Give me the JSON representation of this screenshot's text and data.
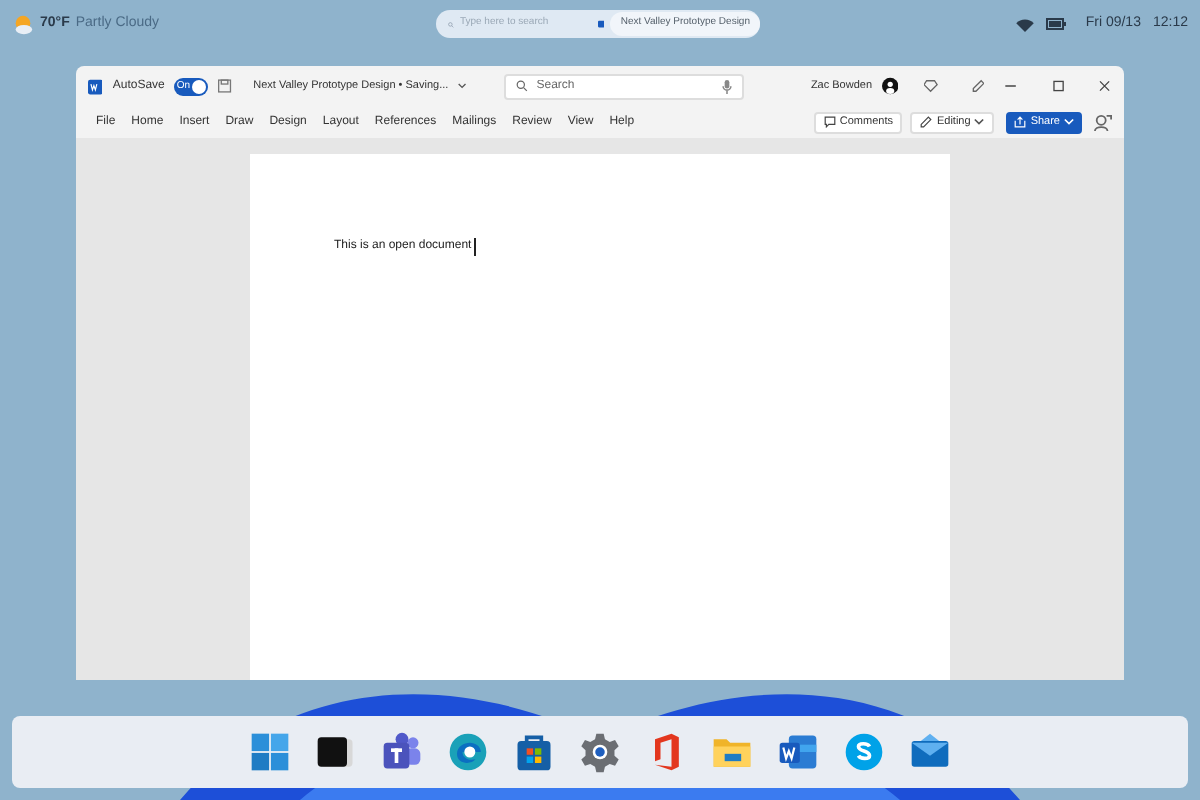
{
  "top_bar": {
    "weather": {
      "temp": "70°F",
      "desc": "Partly Cloudy"
    },
    "search": {
      "placeholder": "Type here to search"
    },
    "search_result": "Next Valley Prototype Design",
    "date": "Fri 09/13",
    "time": "12:12"
  },
  "window": {
    "autosave": {
      "label": "AutoSave",
      "toggle": "On",
      "on": true
    },
    "title": "Next Valley Prototype Design • Saving...",
    "search": {
      "placeholder": "Search"
    },
    "user": "Zac Bowden",
    "menu": [
      {
        "label": "File",
        "selected": false
      },
      {
        "label": "Home",
        "selected": false
      },
      {
        "label": "Insert",
        "selected": false
      },
      {
        "label": "Draw",
        "selected": false
      },
      {
        "label": "Design",
        "selected": false
      },
      {
        "label": "Layout",
        "selected": false
      },
      {
        "label": "References",
        "selected": false
      },
      {
        "label": "Mailings",
        "selected": false
      },
      {
        "label": "Review",
        "selected": false
      },
      {
        "label": "View",
        "selected": false
      },
      {
        "label": "Help",
        "selected": false
      }
    ],
    "comments": "Comments",
    "editing": "Editing",
    "share": "Share",
    "document_text": "This is an open document"
  },
  "taskbar": [
    {
      "kind": "start"
    },
    {
      "kind": "terminal"
    },
    {
      "kind": "teams"
    },
    {
      "kind": "edge"
    },
    {
      "kind": "store"
    },
    {
      "kind": "settings"
    },
    {
      "kind": "office"
    },
    {
      "kind": "folder"
    },
    {
      "kind": "word"
    },
    {
      "kind": "skype"
    },
    {
      "kind": "mail"
    }
  ]
}
